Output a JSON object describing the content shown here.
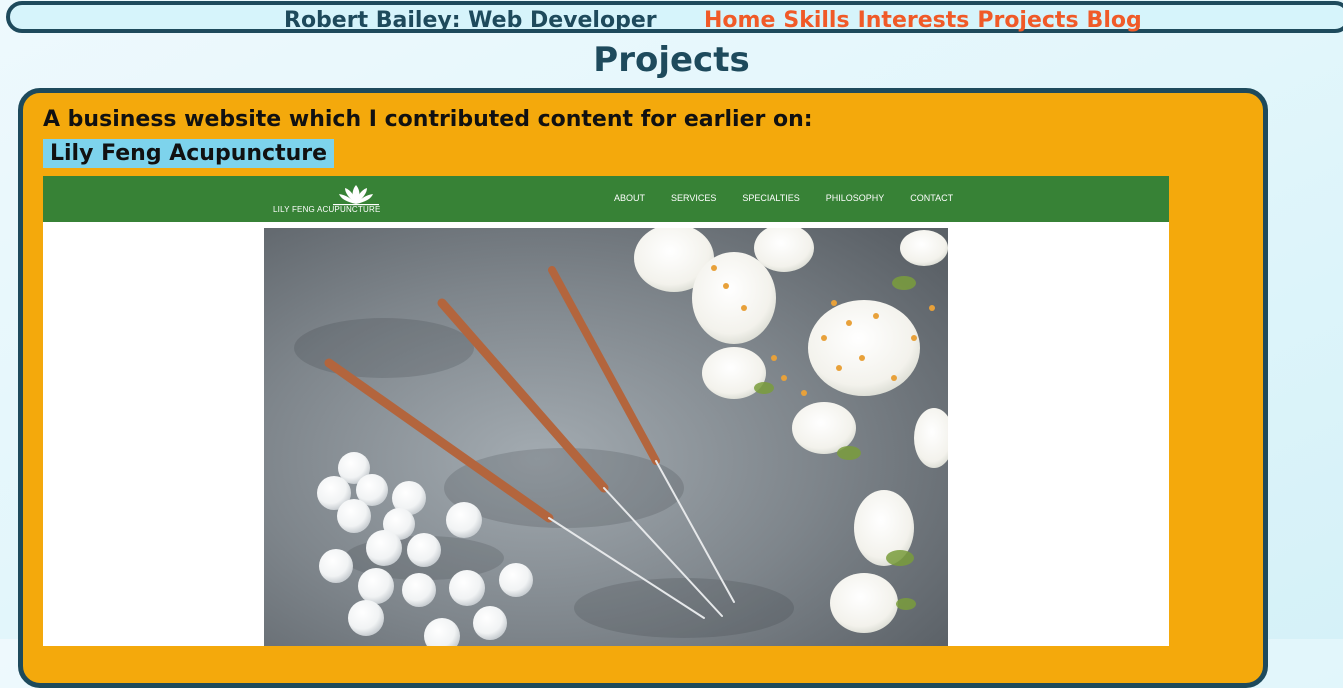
{
  "header": {
    "brand": "Robert Bailey: Web Developer",
    "nav": [
      "Home",
      "Skills",
      "Interests",
      "Projects",
      "Blog"
    ]
  },
  "page": {
    "title": "Projects"
  },
  "project": {
    "intro": "A business website which I contributed content for earlier on:",
    "link_label": "Lily Feng Acupuncture",
    "screenshot": {
      "logo_text": "LILY FENG ACUPUNCTURE",
      "menu": [
        "ABOUT",
        "SERVICES",
        "SPECIALTIES",
        "PHILOSOPHY",
        "CONTACT"
      ]
    }
  },
  "colors": {
    "header_border": "#1e4a5c",
    "nav_link": "#f05a28",
    "card_bg": "#f4a90c",
    "link_highlight": "#7dd3ec",
    "site_nav_green": "#378236"
  }
}
